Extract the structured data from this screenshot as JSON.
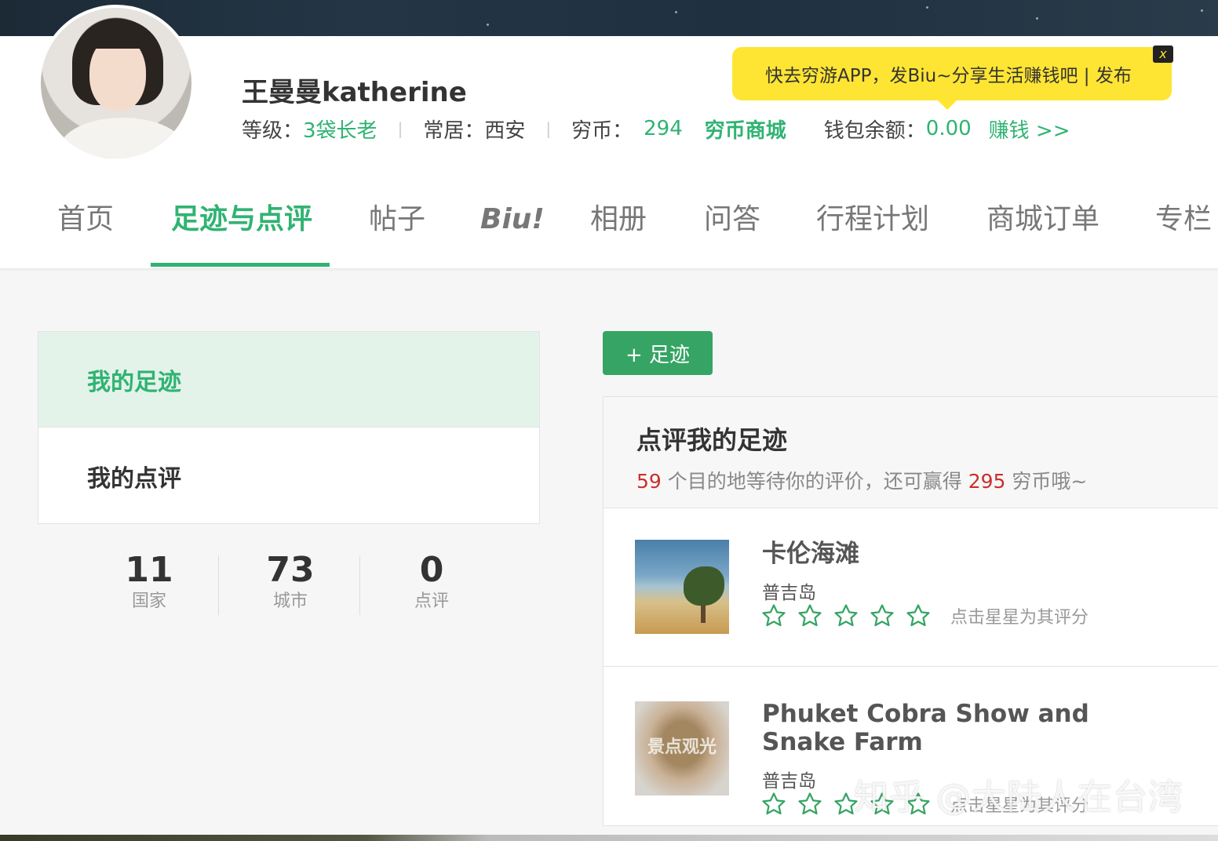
{
  "profile": {
    "username": "王曼曼katherine",
    "level_label": "等级：",
    "level_value": "3袋长老",
    "residence_label": "常居：",
    "residence_value": "西安",
    "coins_label": "穷币：",
    "coins_value": "294",
    "coin_mall": "穷币商城",
    "wallet_label": "钱包余额：",
    "wallet_value": "0.00",
    "earn_link": "赚钱 >>",
    "separator": "|"
  },
  "tooltip": {
    "text": "快去穷游APP，发Biu~分享生活赚钱吧 | 发布",
    "close": "x"
  },
  "nav": {
    "items": [
      {
        "label": "首页",
        "active": false
      },
      {
        "label": "足迹与点评",
        "active": true
      },
      {
        "label": "帖子",
        "active": false
      },
      {
        "label": "Biu!",
        "active": false
      },
      {
        "label": "相册",
        "active": false
      },
      {
        "label": "问答",
        "active": false
      },
      {
        "label": "行程计划",
        "active": false
      },
      {
        "label": "商城订单",
        "active": false
      },
      {
        "label": "专栏",
        "active": false
      }
    ]
  },
  "sidebar": {
    "items": [
      {
        "label": "我的足迹",
        "active": true
      },
      {
        "label": "我的点评",
        "active": false
      }
    ]
  },
  "stats": [
    {
      "value": "11",
      "label": "国家"
    },
    {
      "value": "73",
      "label": "城市"
    },
    {
      "value": "0",
      "label": "点评"
    }
  ],
  "add_button": "+ 足迹",
  "review": {
    "title": "点评我的足迹",
    "pending_count": "59",
    "sub_text_1": " 个目的地等待你的评价，还可赢得 ",
    "reward_coins": "295",
    "sub_text_2": " 穷币哦~",
    "star_hint": "点击星星为其评分",
    "items": [
      {
        "name": "卡伦海滩",
        "location": "普吉岛",
        "thumb": "beach-photo"
      },
      {
        "name": "Phuket Cobra Show and Snake Farm",
        "location": "普吉岛",
        "thumb": "scenic-placeholder",
        "thumb_label": "景点观光"
      }
    ]
  },
  "watermark": "知乎 @大陆人在台湾",
  "colors": {
    "accent": "#30b372",
    "button": "#36a464",
    "highlight": "#c9302c",
    "tooltip": "#ffe533"
  }
}
